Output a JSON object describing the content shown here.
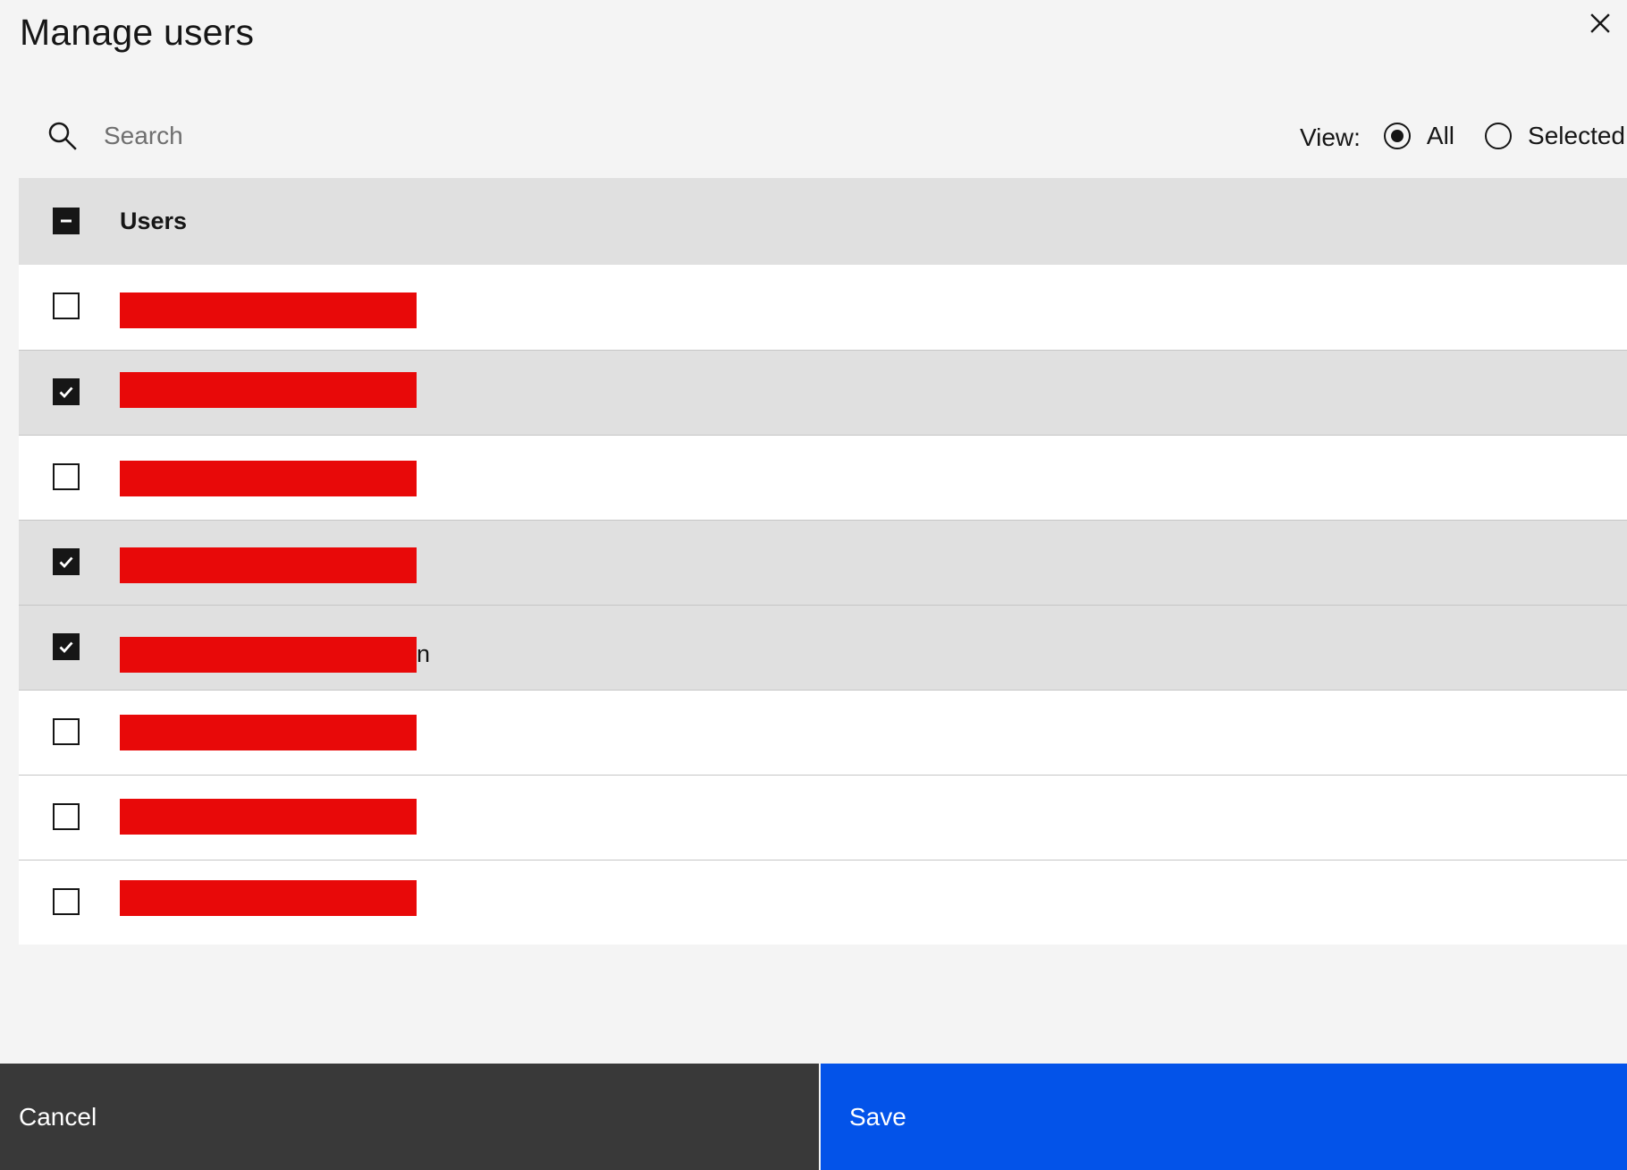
{
  "modal": {
    "title": "Manage users",
    "close_icon": "close-icon"
  },
  "search": {
    "icon": "search-icon",
    "placeholder": "Search",
    "value": ""
  },
  "view": {
    "label": "View:",
    "options": [
      {
        "label": "All",
        "selected": true
      },
      {
        "label": "Selected",
        "selected": false
      }
    ]
  },
  "table": {
    "header": {
      "label": "Users",
      "select_all_state": "indeterminate"
    },
    "rows": [
      {
        "checked": false,
        "name_redacted": true
      },
      {
        "checked": true,
        "name_redacted": true
      },
      {
        "checked": false,
        "name_redacted": true
      },
      {
        "checked": true,
        "name_redacted": true
      },
      {
        "checked": true,
        "name_redacted": true,
        "visible_fragment": "n"
      },
      {
        "checked": false,
        "name_redacted": true
      },
      {
        "checked": false,
        "name_redacted": true
      },
      {
        "checked": false,
        "name_redacted": true
      }
    ]
  },
  "footer": {
    "cancel_label": "Cancel",
    "save_label": "Save"
  },
  "colors": {
    "background": "#f4f4f4",
    "header_row": "#e0e0e0",
    "selected_row": "#e0e0e0",
    "unselected_row": "#ffffff",
    "redaction": "#e80909",
    "cancel_button": "#393939",
    "save_button": "#0353e9",
    "text": "#161616",
    "placeholder": "#6f6f6f"
  }
}
